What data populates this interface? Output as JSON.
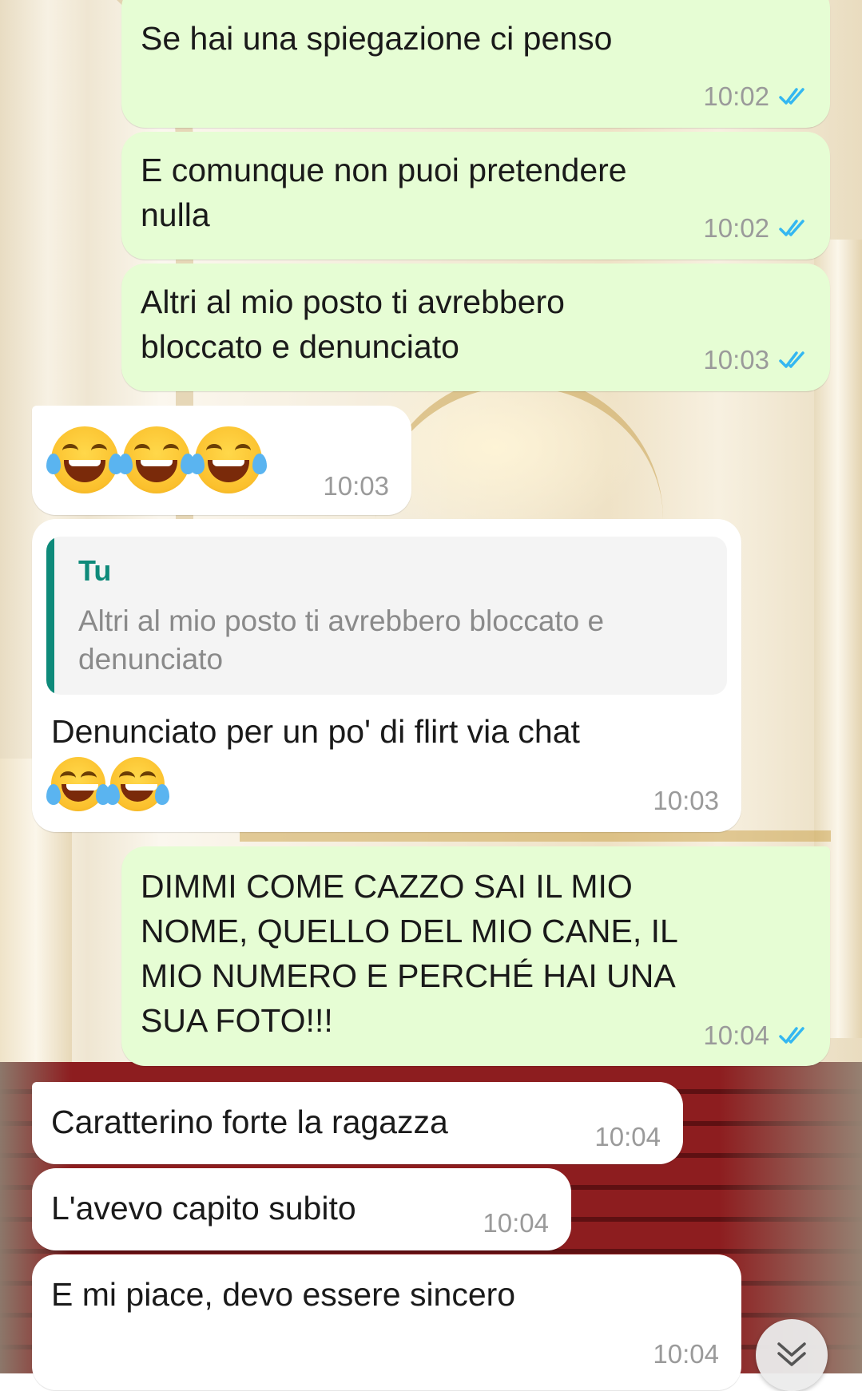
{
  "chat": {
    "messages": [
      {
        "direction": "outgoing",
        "text": "Se hai una spiegazione ci penso",
        "time": "10:02",
        "status_icon": "double-check-read-icon"
      },
      {
        "direction": "outgoing",
        "lines": [
          "E comunque non puoi pretendere",
          "nulla"
        ],
        "time": "10:02",
        "status_icon": "double-check-read-icon"
      },
      {
        "direction": "outgoing",
        "lines": [
          "Altri al mio posto ti avrebbero",
          "bloccato e denunciato"
        ],
        "time": "10:03",
        "status_icon": "double-check-read-icon"
      },
      {
        "direction": "incoming",
        "emoji": [
          "face-with-tears-of-joy",
          "face-with-tears-of-joy",
          "face-with-tears-of-joy"
        ],
        "time": "10:03"
      },
      {
        "direction": "incoming",
        "quote": {
          "author": "Tu",
          "lines": [
            "Altri al mio posto ti avrebbero bloccato e",
            "denunciato"
          ]
        },
        "text": "Denunciato per un po' di flirt via chat",
        "emoji": [
          "face-with-tears-of-joy",
          "face-with-tears-of-joy"
        ],
        "time": "10:03"
      },
      {
        "direction": "outgoing",
        "lines": [
          "DIMMI COME CAZZO SAI IL MIO",
          "NOME, QUELLO DEL MIO CANE, IL",
          "MIO NUMERO E PERCHÉ HAI UNA",
          "SUA FOTO!!!"
        ],
        "time": "10:04",
        "status_icon": "double-check-read-icon"
      },
      {
        "direction": "incoming",
        "text": "Caratterino forte la ragazza",
        "time": "10:04"
      },
      {
        "direction": "incoming",
        "text": "L'avevo capito subito",
        "time": "10:04"
      },
      {
        "direction": "incoming",
        "text": "E mi piace, devo essere sincero",
        "time": "10:04"
      }
    ]
  },
  "controls": {
    "scroll_down_icon": "double-chevron-down-icon"
  },
  "colors": {
    "outgoing_bubble": "#e6fdd4",
    "incoming_bubble": "#ffffff",
    "read_check": "#34b7f1",
    "quote_accent": "#0e8a7a",
    "timestamp": "#9a9a9a"
  }
}
